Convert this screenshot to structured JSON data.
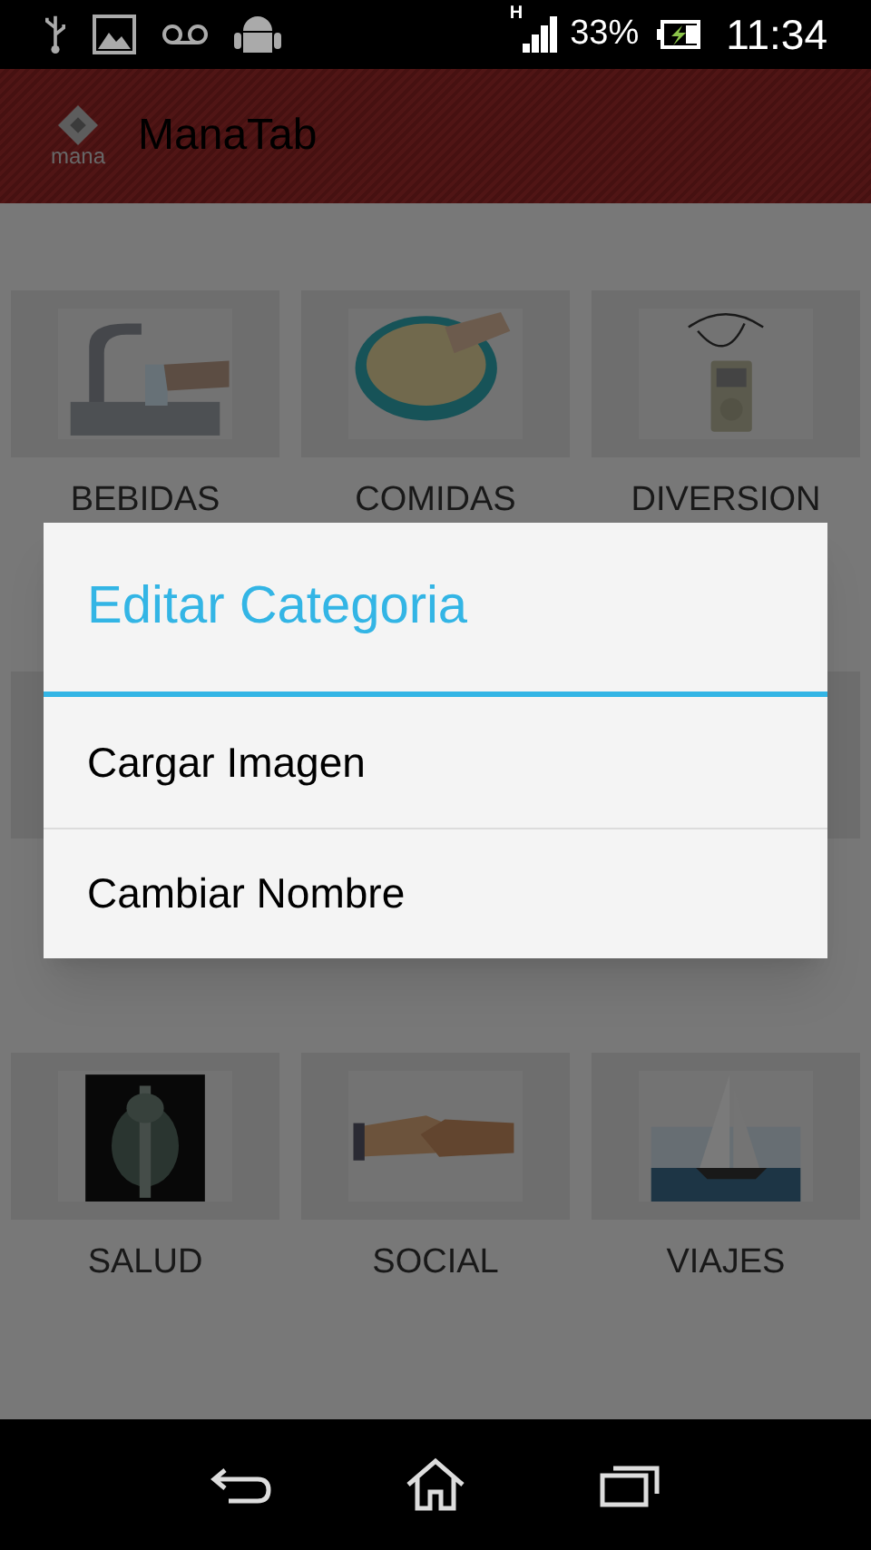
{
  "status_bar": {
    "network_type": "H",
    "battery": "33%",
    "time": "11:34"
  },
  "app_bar": {
    "logo_text": "mana",
    "title": "ManaTab"
  },
  "grid": [
    [
      {
        "label": "BEBIDAS",
        "kind": "picture"
      },
      {
        "label": "COMIDAS",
        "kind": "picture"
      },
      {
        "label": "DIVERSION",
        "kind": "picture"
      }
    ],
    [
      {
        "kind": "tile"
      },
      {
        "kind": "hidden"
      },
      {
        "kind": "tile"
      }
    ],
    [
      {
        "label": "SALUD",
        "kind": "picture"
      },
      {
        "label": "SOCIAL",
        "kind": "picture"
      },
      {
        "label": "VIAJES",
        "kind": "picture"
      }
    ]
  ],
  "dialog": {
    "title": "Editar Categoria",
    "items": [
      "Cargar Imagen",
      "Cambiar Nombre"
    ]
  }
}
